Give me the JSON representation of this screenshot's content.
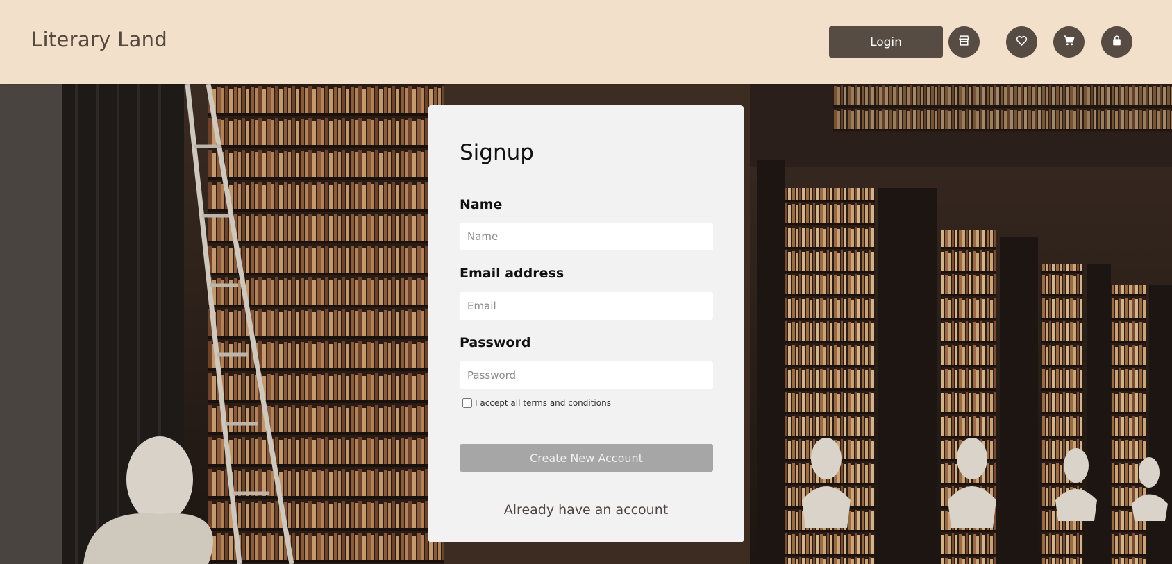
{
  "header": {
    "brand": "Literary Land",
    "login_label": "Login",
    "icons": [
      "store-icon",
      "heart-icon",
      "cart-icon",
      "bag-icon"
    ]
  },
  "signup": {
    "title": "Signup",
    "name_label": "Name",
    "name_placeholder": "Name",
    "email_label": "Email address",
    "email_placeholder": "Email",
    "password_label": "Password",
    "password_placeholder": "Password",
    "terms_label": "I accept all terms and conditions",
    "terms_checked": false,
    "create_label": "Create New Account",
    "already_label": "Already have an account"
  },
  "colors": {
    "header_bg": "#f3e0cb",
    "brand_text": "#55493f",
    "button_dark": "#574c43",
    "card_bg": "#f2f2f2",
    "create_btn": "#a6a6a6"
  }
}
